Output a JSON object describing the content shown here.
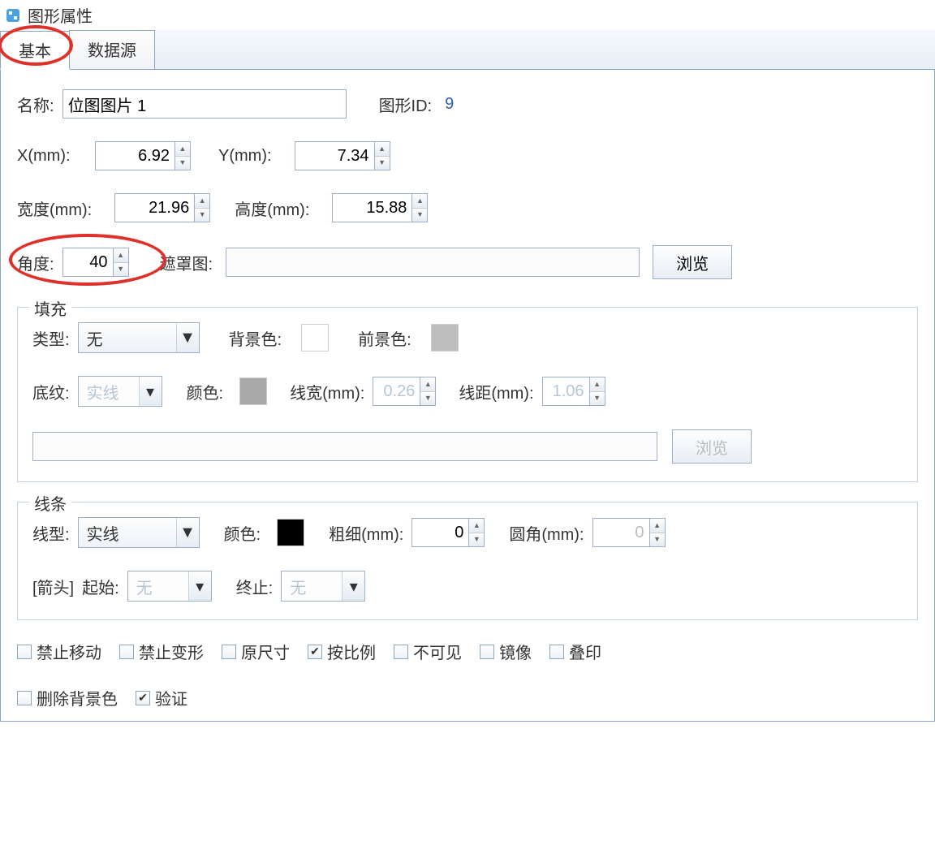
{
  "title": "图形属性",
  "tabs": {
    "basic": "基本",
    "datasource": "数据源"
  },
  "labels": {
    "name": "名称:",
    "shapeid": "图形ID:",
    "x": "X(mm):",
    "y": "Y(mm):",
    "width": "宽度(mm):",
    "height": "高度(mm):",
    "angle": "角度:",
    "mask": "遮罩图:",
    "browse": "浏览",
    "fill": "填充",
    "type": "类型:",
    "bgcolor": "背景色:",
    "fgcolor": "前景色:",
    "pattern": "底纹:",
    "color": "颜色:",
    "linewidth": "线宽(mm):",
    "linedist": "线距(mm):",
    "line": "线条",
    "linetype": "线型:",
    "thickness": "粗细(mm):",
    "radius": "圆角(mm):",
    "arrow": "[箭头]",
    "start": "起始:",
    "end": "终止:"
  },
  "values": {
    "name": "位图图片 1",
    "shapeid": "9",
    "x": "6.92",
    "y": "7.34",
    "width": "21.96",
    "height": "15.88",
    "angle": "40",
    "mask": "",
    "fillType": "无",
    "pattern": "实线",
    "lineWidth": "0.26",
    "lineDist": "1.06",
    "lineType": "实线",
    "thickness": "0",
    "radius": "0",
    "arrowStart": "无",
    "arrowEnd": "无"
  },
  "checks": {
    "noMove": "禁止移动",
    "noResize": "禁止变形",
    "origSize": "原尺寸",
    "ratio": "按比例",
    "invisible": "不可见",
    "mirror": "镜像",
    "overprint": "叠印",
    "delBg": "删除背景色",
    "validate": "验证"
  },
  "checked": {
    "ratio": true,
    "validate": true
  }
}
